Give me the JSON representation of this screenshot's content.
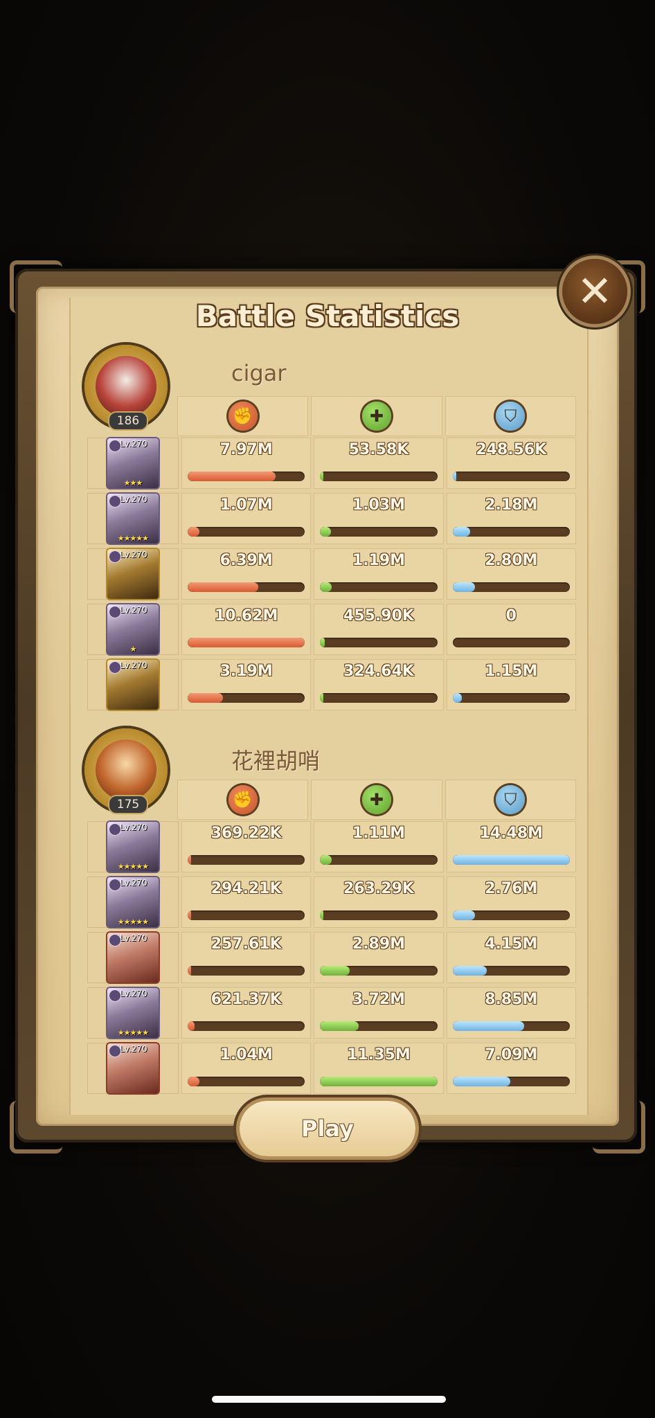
{
  "title": "Battle Statistics",
  "play_label": "Play",
  "close_icon": "close-icon",
  "stat_icons": [
    "damage-icon",
    "heal-icon",
    "shield-icon"
  ],
  "players": [
    {
      "name": "cigar",
      "level": "186",
      "heroes": [
        {
          "level": "Lv.270",
          "stars": "★★★",
          "frame": "purple",
          "damage": {
            "text": "7.97M",
            "pct": 75
          },
          "heal": {
            "text": "53.58K",
            "pct": 1
          },
          "shield": {
            "text": "248.56K",
            "pct": 2
          }
        },
        {
          "level": "Lv.270",
          "stars": "★★★★★",
          "frame": "purple",
          "damage": {
            "text": "1.07M",
            "pct": 10
          },
          "heal": {
            "text": "1.03M",
            "pct": 9
          },
          "shield": {
            "text": "2.18M",
            "pct": 15
          }
        },
        {
          "level": "Lv.270",
          "stars": "",
          "frame": "gold",
          "damage": {
            "text": "6.39M",
            "pct": 60
          },
          "heal": {
            "text": "1.19M",
            "pct": 10
          },
          "shield": {
            "text": "2.80M",
            "pct": 19
          }
        },
        {
          "level": "Lv.270",
          "stars": "★",
          "frame": "purple",
          "damage": {
            "text": "10.62M",
            "pct": 100
          },
          "heal": {
            "text": "455.90K",
            "pct": 4
          },
          "shield": {
            "text": "0",
            "pct": 0
          }
        },
        {
          "level": "Lv.270",
          "stars": "",
          "frame": "gold",
          "damage": {
            "text": "3.19M",
            "pct": 30
          },
          "heal": {
            "text": "324.64K",
            "pct": 3
          },
          "shield": {
            "text": "1.15M",
            "pct": 8
          }
        }
      ]
    },
    {
      "name": "花裡胡哨",
      "level": "175",
      "heroes": [
        {
          "level": "Lv.270",
          "stars": "★★★★★",
          "frame": "purple",
          "damage": {
            "text": "369.22K",
            "pct": 3
          },
          "heal": {
            "text": "1.11M",
            "pct": 10
          },
          "shield": {
            "text": "14.48M",
            "pct": 100
          }
        },
        {
          "level": "Lv.270",
          "stars": "★★★★★",
          "frame": "purple",
          "damage": {
            "text": "294.21K",
            "pct": 3
          },
          "heal": {
            "text": "263.29K",
            "pct": 2
          },
          "shield": {
            "text": "2.76M",
            "pct": 19
          }
        },
        {
          "level": "Lv.270",
          "stars": "",
          "frame": "red",
          "damage": {
            "text": "257.61K",
            "pct": 2
          },
          "heal": {
            "text": "2.89M",
            "pct": 25
          },
          "shield": {
            "text": "4.15M",
            "pct": 29
          }
        },
        {
          "level": "Lv.270",
          "stars": "★★★★★",
          "frame": "purple",
          "damage": {
            "text": "621.37K",
            "pct": 6
          },
          "heal": {
            "text": "3.72M",
            "pct": 33
          },
          "shield": {
            "text": "8.85M",
            "pct": 61
          }
        },
        {
          "level": "Lv.270",
          "stars": "",
          "frame": "red",
          "damage": {
            "text": "1.04M",
            "pct": 10
          },
          "heal": {
            "text": "11.35M",
            "pct": 100
          },
          "shield": {
            "text": "7.09M",
            "pct": 49
          }
        }
      ]
    }
  ]
}
